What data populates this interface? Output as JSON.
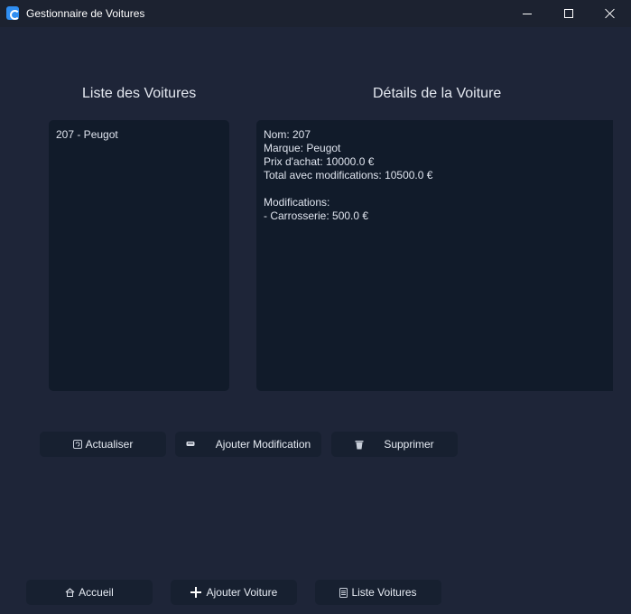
{
  "window": {
    "title": "Gestionnaire de Voitures"
  },
  "headings": {
    "list": "Liste des Voitures",
    "details": "Détails de la Voiture"
  },
  "car_list": [
    {
      "label": "207 - Peugot"
    }
  ],
  "details": {
    "lines": [
      "Nom: 207",
      "Marque: Peugot",
      "Prix d'achat: 10000.0 €",
      "Total avec modifications: 10500.0 €",
      "",
      "Modifications:",
      "- Carrosserie: 500.0 €"
    ]
  },
  "actions": {
    "refresh": "Actualiser",
    "add_modification": "Ajouter Modification",
    "delete": "Supprimer"
  },
  "nav": {
    "home": "Accueil",
    "add_car": "Ajouter Voiture",
    "car_list": "Liste Voitures"
  },
  "icons": {
    "refresh": "refresh-icon",
    "add_modification": "tools-icon",
    "delete": "trash-icon",
    "home": "house-icon",
    "add_car": "plus-icon",
    "car_list": "list-icon"
  },
  "colors": {
    "background": "#1e2538",
    "panel": "#111b2a",
    "button": "#172030",
    "titlebar": "#1c2230",
    "accent": "#2f8ef2"
  }
}
